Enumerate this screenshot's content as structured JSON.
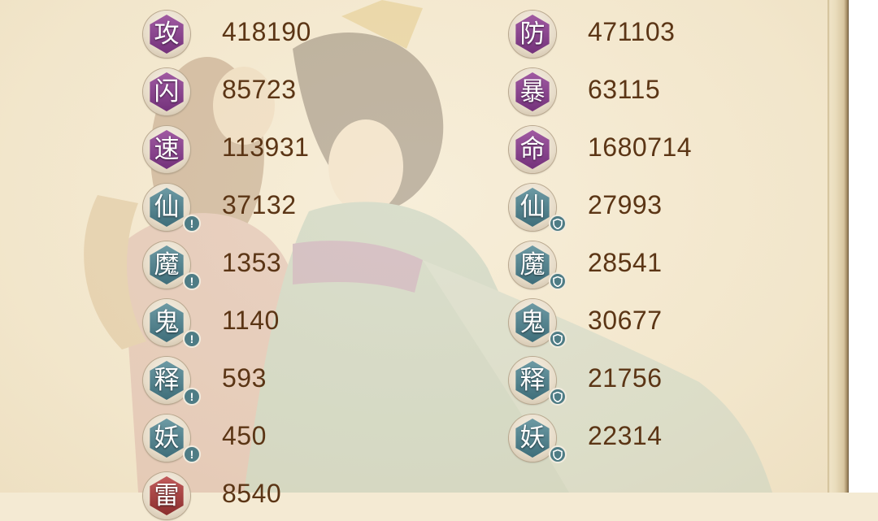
{
  "stats": [
    {
      "char": "攻",
      "value": "418190",
      "style": "purple",
      "mark": ""
    },
    {
      "char": "防",
      "value": "471103",
      "style": "purple",
      "mark": ""
    },
    {
      "char": "闪",
      "value": "85723",
      "style": "purple",
      "mark": ""
    },
    {
      "char": "暴",
      "value": "63115",
      "style": "purple",
      "mark": ""
    },
    {
      "char": "速",
      "value": "113931",
      "style": "purple",
      "mark": ""
    },
    {
      "char": "命",
      "value": "1680714",
      "style": "purple",
      "mark": ""
    },
    {
      "char": "仙",
      "value": "37132",
      "style": "teal",
      "mark": "attack"
    },
    {
      "char": "仙",
      "value": "27993",
      "style": "teal",
      "mark": "shield"
    },
    {
      "char": "魔",
      "value": "1353",
      "style": "teal",
      "mark": "attack"
    },
    {
      "char": "魔",
      "value": "28541",
      "style": "teal",
      "mark": "shield"
    },
    {
      "char": "鬼",
      "value": "1140",
      "style": "teal",
      "mark": "attack"
    },
    {
      "char": "鬼",
      "value": "30677",
      "style": "teal",
      "mark": "shield"
    },
    {
      "char": "释",
      "value": "593",
      "style": "teal",
      "mark": "attack"
    },
    {
      "char": "释",
      "value": "21756",
      "style": "teal",
      "mark": "shield"
    },
    {
      "char": "妖",
      "value": "450",
      "style": "teal",
      "mark": "attack"
    },
    {
      "char": "妖",
      "value": "22314",
      "style": "teal",
      "mark": "shield"
    },
    {
      "char": "雷",
      "value": "8540",
      "style": "red",
      "mark": ""
    }
  ]
}
